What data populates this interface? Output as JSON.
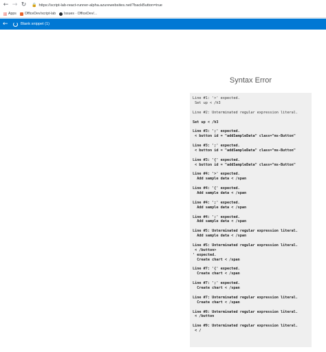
{
  "browser": {
    "url": "https://script-lab-react-runner-alpha.azurewebsites.net/?backButton=true",
    "bookmarks": [
      {
        "label": "Apps"
      },
      {
        "label": "OfficeDev/script-lab"
      },
      {
        "label": "Issues · OfficeDev/..."
      }
    ]
  },
  "header": {
    "title": "Blank snippet (1)"
  },
  "page": {
    "title": "Syntax Error"
  },
  "errors": [
    {
      "text": "Line #1: '>' expected.\n Set up < /h3",
      "bold": false
    },
    {
      "text": "Line #2: Unterminated regular expression literal.",
      "bold": false
    },
    {
      "text": "Set up < /h3",
      "bold": true
    },
    {
      "text": "Line #3: ';' expected.\n < button id = \"addSampleData\" class=\"ms-Button\"",
      "bold": true
    },
    {
      "text": "Line #3: ';' expected.\n < button id = \"addSampleData\" class=\"ms-Button\"",
      "bold": true
    },
    {
      "text": "Line #3: '{' expected.\n < button id = \"addSampleData\" class=\"ms-Button\"",
      "bold": true
    },
    {
      "text": "Line #4: '>' expected.\n  Add sample data < /span",
      "bold": true
    },
    {
      "text": "Line #4: '{' expected.\n  Add sample data < /span",
      "bold": true
    },
    {
      "text": "Line #4: ';' expected.\n  Add sample data < /span",
      "bold": true
    },
    {
      "text": "Line #4: ';' expected.\n  Add sample data < /span",
      "bold": true
    },
    {
      "text": "Line #5: Unterminated regular expression literal.\n  Add sample data < /span",
      "bold": true
    },
    {
      "text": "Line #5: Unterminated regular expression literal.\n < /button>\n' expected.\n  Create chart < /span",
      "bold": true
    },
    {
      "text": "Line #7: '{' expected.\n  Create chart < /span",
      "bold": true
    },
    {
      "text": "Line #7: ';' expected.\n  Create chart < /span",
      "bold": true
    },
    {
      "text": "Line #7: Unterminated regular expression literal.\n  Create chart < /span",
      "bold": true
    },
    {
      "text": "Line #8: Unterminated regular expression literal.\n < /button",
      "bold": true
    },
    {
      "text": "Line #9: Unterminated regular expression literal.\n < /",
      "bold": true
    }
  ]
}
